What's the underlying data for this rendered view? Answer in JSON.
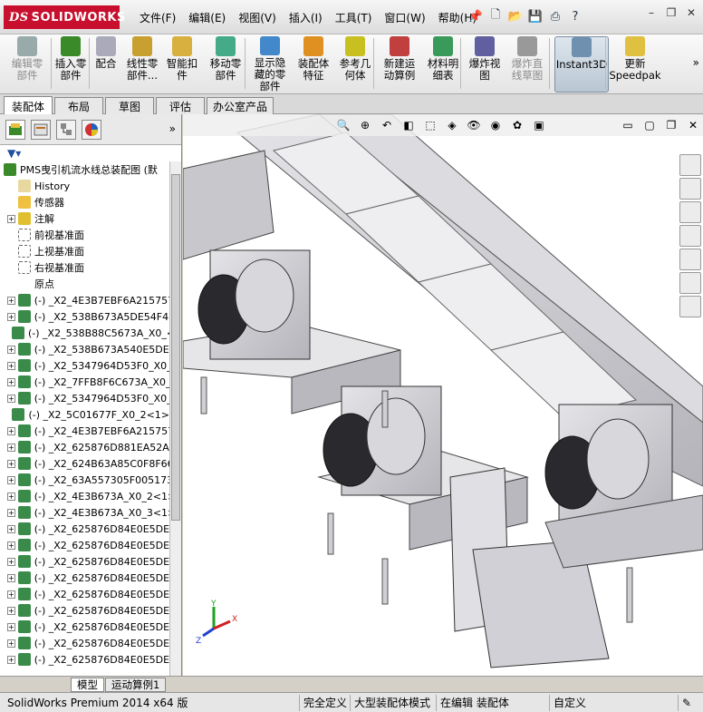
{
  "app": {
    "brand": "SOLIDWORKS",
    "brand_mark": "DS",
    "menu": [
      "文件(F)",
      "编辑(E)",
      "视图(V)",
      "插入(I)",
      "工具(T)",
      "窗口(W)",
      "帮助(H)"
    ]
  },
  "command_manager": {
    "buttons": [
      {
        "label1": "编辑零",
        "label2": "部件",
        "enabled": false
      },
      {
        "label1": "插入零",
        "label2": "部件",
        "enabled": true
      },
      {
        "label1": "配合",
        "label2": "",
        "enabled": true
      },
      {
        "label1": "线性零",
        "label2": "部件...",
        "enabled": true
      },
      {
        "label1": "智能扣",
        "label2": "件",
        "enabled": true
      },
      {
        "label1": "移动零",
        "label2": "部件",
        "enabled": true
      },
      {
        "label1": "显示隐",
        "label2": "藏的零",
        "label3": "部件",
        "enabled": true
      },
      {
        "label1": "装配体",
        "label2": "特征",
        "enabled": true
      },
      {
        "label1": "参考几",
        "label2": "何体",
        "enabled": true
      },
      {
        "label1": "新建运",
        "label2": "动算例",
        "enabled": true
      },
      {
        "label1": "材料明",
        "label2": "细表",
        "enabled": true
      },
      {
        "label1": "爆炸视",
        "label2": "图",
        "enabled": true
      },
      {
        "label1": "爆炸直",
        "label2": "线草图",
        "enabled": false
      },
      {
        "label1": "Instant3D",
        "label2": "",
        "enabled": true,
        "active": true
      },
      {
        "label1": "更新",
        "label2": "Speedpak",
        "enabled": true
      }
    ],
    "tabs": [
      "装配体",
      "布局",
      "草图",
      "评估",
      "办公室产品"
    ]
  },
  "feature_tree": {
    "root": "PMS曳引机流水线总装配图 (默",
    "items": [
      {
        "label": "History",
        "toggle": ""
      },
      {
        "label": "传感器",
        "toggle": ""
      },
      {
        "label": "注解",
        "toggle": "+"
      },
      {
        "label": "前视基准面",
        "toggle": ""
      },
      {
        "label": "上视基准面",
        "toggle": ""
      },
      {
        "label": "右视基准面",
        "toggle": ""
      },
      {
        "label": "原点",
        "toggle": ""
      },
      {
        "label": "(-) _X2_4E3B7EBF6A215757_",
        "toggle": "+"
      },
      {
        "label": "(-) _X2_538B673A5DE54F4D6",
        "toggle": "+"
      },
      {
        "label": "(-) _X2_538B88C5673A_X0_<",
        "toggle": ""
      },
      {
        "label": "(-) _X2_538B673A540E5DE54",
        "toggle": "+"
      },
      {
        "label": "(-) _X2_5347964D53F0_X0_2",
        "toggle": "+"
      },
      {
        "label": "(-) _X2_7FFB8F6C673A_X0_<",
        "toggle": "+"
      },
      {
        "label": "(-) _X2_5347964D53F0_X0_1",
        "toggle": "+"
      },
      {
        "label": "(-) _X2_5C01677F_X0_2<1>",
        "toggle": ""
      },
      {
        "label": "(-) _X2_4E3B7EBF6A215757_",
        "toggle": "+"
      },
      {
        "label": "(-) _X2_625876D881EA52A87",
        "toggle": "+"
      },
      {
        "label": "(-) _X2_624B63A85C0F8F66_",
        "toggle": "+"
      },
      {
        "label": "(-) _X2_63A557305F0051736",
        "toggle": "+"
      },
      {
        "label": "(-) _X2_4E3B673A_X0_2<1>",
        "toggle": "+"
      },
      {
        "label": "(-) _X2_4E3B673A_X0_3<1>",
        "toggle": "+"
      },
      {
        "label": "(-) _X2_625876D84E0E5DE54",
        "toggle": "+"
      },
      {
        "label": "(-) _X2_625876D84E0E5DE54",
        "toggle": "+"
      },
      {
        "label": "(-) _X2_625876D84E0E5DE54",
        "toggle": "+"
      },
      {
        "label": "(-) _X2_625876D84E0E5DE54",
        "toggle": "+"
      },
      {
        "label": "(-) _X2_625876D84E0E5DE54",
        "toggle": "+"
      },
      {
        "label": "(-) _X2_625876D84E0E5DE54",
        "toggle": "+"
      },
      {
        "label": "(-) _X2_625876D84E0E5DE54",
        "toggle": "+"
      },
      {
        "label": "(-) _X2_625876D84E0E5DE54",
        "toggle": "+"
      },
      {
        "label": "(-) _X2_625876D84E0E5DE54",
        "toggle": "+"
      }
    ]
  },
  "bottom_tabs": [
    "模型",
    "运动算例1"
  ],
  "status": {
    "product": "SolidWorks Premium 2014 x64 版",
    "definition": "完全定义",
    "mode": "大型装配体模式",
    "editing": "在编辑 装配体",
    "units": "自定义"
  },
  "triad": {
    "x": "X",
    "y": "Y",
    "z": "Z"
  },
  "colors": {
    "brand_red": "#c8102e",
    "model_gray": "#d0d0d4",
    "triad_x": "#d02020",
    "triad_y": "#20a020",
    "triad_z": "#2040d0"
  }
}
